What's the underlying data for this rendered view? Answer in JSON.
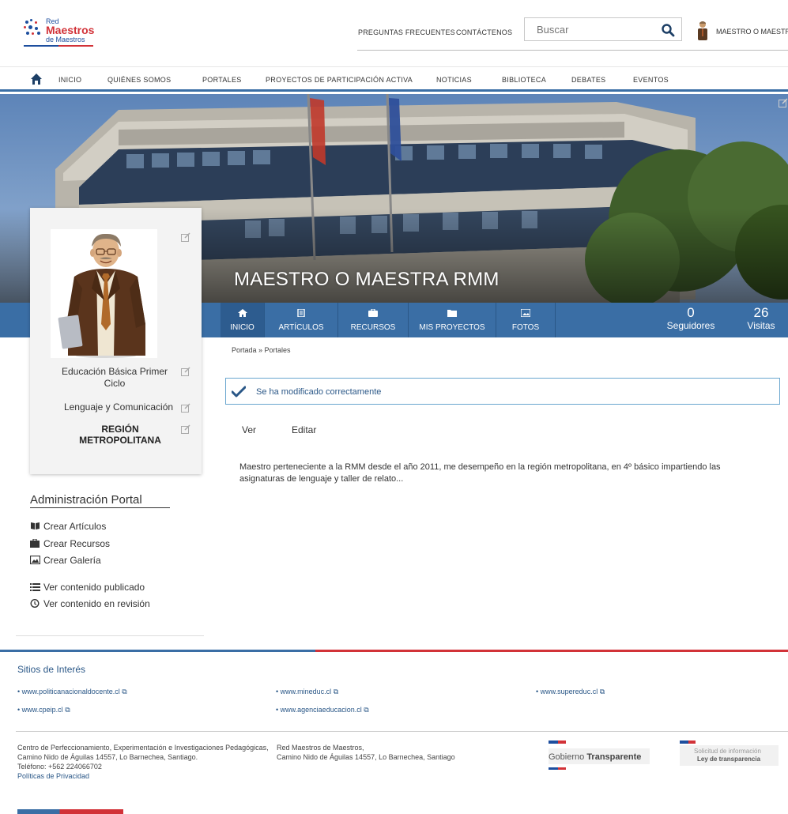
{
  "logo": {
    "line1": "Red",
    "line2": "Maestros",
    "line3": "de Maestros"
  },
  "header": {
    "faq": "PREGUNTAS FRECUENTES",
    "contact": "CONTÁCTENOS",
    "search_placeholder": "Buscar",
    "user_name": "MAESTRO O MAESTRA"
  },
  "nav": [
    "INICIO",
    "QUIÉNES SOMOS",
    "PORTALES",
    "PROYECTOS DE PARTICIPACIÓN ACTIVA",
    "NOTICIAS",
    "BIBLIOTECA",
    "DEBATES",
    "EVENTOS"
  ],
  "profile": {
    "name": "MAESTRO O MAESTRA RMM",
    "level": "Educación Básica Primer Ciclo",
    "subject": "Lenguaje y Comunicación",
    "region": "REGIÓN METROPOLITANA"
  },
  "tabs": [
    "INICIO",
    "ARTÍCULOS",
    "RECURSOS",
    "MIS PROYECTOS",
    "FOTOS"
  ],
  "stats": {
    "followers_count": "0",
    "followers_label": "Seguidores",
    "visits_count": "26",
    "visits_label": "Visitas"
  },
  "breadcrumb": "Portada » Portales",
  "alert": "Se ha modificado correctamente",
  "view_tabs": {
    "view": "Ver",
    "edit": "Editar"
  },
  "description": "Maestro perteneciente a la RMM desde el año 2011, me desempeño en la región metropolitana, en 4º básico impartiendo las asignaturas de lenguaje y taller de relato...",
  "admin": {
    "title": "Administración Portal",
    "items": [
      "Crear Artículos",
      "Crear Recursos",
      "Crear Galería",
      "Ver contenido publicado",
      "Ver contenido en revisión"
    ]
  },
  "footer": {
    "sites_title": "Sitios de Interés",
    "sites": [
      "www.politicanacionaldocente.cl",
      "www.mineduc.cl",
      "www.supereduc.cl",
      "www.cpeip.cl",
      "www.agenciaeducacion.cl"
    ],
    "cpeip_name": "Centro de Perfeccionamiento, Experimentación e Investigaciones Pedagógicas,",
    "cpeip_address": "Camino Nido de Águilas 14557, Lo Barnechea, Santiago.",
    "cpeip_phone": "Teléfono: +562 224066702",
    "privacy": "Políticas de Privacidad",
    "rmm_name": "Red Maestros de Maestros,",
    "rmm_address": "Camino Nido de Águilas 14557, Lo Barnechea, Santiago",
    "gob_text1": "Gobierno ",
    "gob_text2": "Transparente",
    "solicitud1": "Solicitud de información",
    "solicitud2": "Ley de transparencia"
  },
  "colors": {
    "primary_blue": "#3a6ea5",
    "red": "#d23238",
    "link": "#2a5787"
  }
}
